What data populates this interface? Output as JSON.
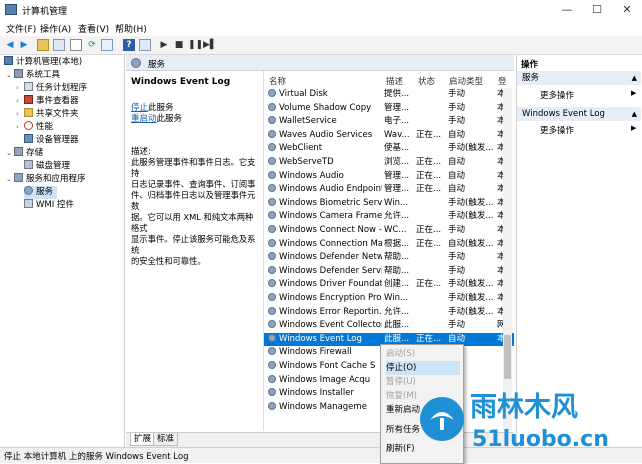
{
  "window": {
    "title": "计算机管理",
    "controls": [
      "—",
      "☐",
      "✕"
    ]
  },
  "menu": [
    "文件(F)",
    "操作(A)",
    "查看(V)",
    "帮助(H)"
  ],
  "tree": {
    "root": "计算机管理(本地)",
    "items": [
      {
        "label": "系统工具",
        "level": 1
      },
      {
        "label": "任务计划程序",
        "level": 2
      },
      {
        "label": "事件查看器",
        "level": 2
      },
      {
        "label": "共享文件夹",
        "level": 2
      },
      {
        "label": "性能",
        "level": 2
      },
      {
        "label": "设备管理器",
        "level": 2
      },
      {
        "label": "存储",
        "level": 1
      },
      {
        "label": "磁盘管理",
        "level": 2
      },
      {
        "label": "服务和应用程序",
        "level": 1
      },
      {
        "label": "服务",
        "level": 2
      },
      {
        "label": "WMI 控件",
        "level": 2
      }
    ]
  },
  "services_header": "服务",
  "description": {
    "title": "Windows Event Log",
    "stop_link": "停止",
    "stop_suffix": "此服务",
    "restart_link": "重启动",
    "restart_suffix": "此服务",
    "desc_label": "描述:",
    "desc_lines": [
      "此服务管理事件和事件日志。它支持",
      "日志记录事件、查询事件、订阅事",
      "件、归档事件日志以及管理事件元数",
      "据。它可以用 XML 和纯文本两种格式",
      "显示事件。停止该服务可能危及系统",
      "的安全性和可靠性。"
    ]
  },
  "columns": {
    "name": "名称",
    "desc": "描述",
    "status": "状态",
    "startup": "启动类型",
    "logon": "登"
  },
  "rows": [
    {
      "name": "Virtual Disk",
      "desc": "提供...",
      "status": "",
      "startup": "手动",
      "logon": "本"
    },
    {
      "name": "Volume Shadow Copy",
      "desc": "管理...",
      "status": "",
      "startup": "手动",
      "logon": "本"
    },
    {
      "name": "WalletService",
      "desc": "电子...",
      "status": "",
      "startup": "手动",
      "logon": "本"
    },
    {
      "name": "Waves Audio Services",
      "desc": "Wav...",
      "status": "正在...",
      "startup": "自动",
      "logon": "本"
    },
    {
      "name": "WebClient",
      "desc": "使基...",
      "status": "",
      "startup": "手动(触发...",
      "logon": "本"
    },
    {
      "name": "WebServeTD",
      "desc": "浏览...",
      "status": "正在...",
      "startup": "自动",
      "logon": "本"
    },
    {
      "name": "Windows Audio",
      "desc": "管理...",
      "status": "正在...",
      "startup": "自动",
      "logon": "本"
    },
    {
      "name": "Windows Audio Endpoint...",
      "desc": "管理...",
      "status": "正在...",
      "startup": "自动",
      "logon": "本"
    },
    {
      "name": "Windows Biometric Servic...",
      "desc": "Win...",
      "status": "",
      "startup": "手动(触发...",
      "logon": "本"
    },
    {
      "name": "Windows Camera Frame ...",
      "desc": "允许...",
      "status": "",
      "startup": "手动(触发...",
      "logon": "本"
    },
    {
      "name": "Windows Connect Now - ...",
      "desc": "WC...",
      "status": "正在...",
      "startup": "手动",
      "logon": "本"
    },
    {
      "name": "Windows Connection Ma...",
      "desc": "根据...",
      "status": "正在...",
      "startup": "自动(触发...",
      "logon": "本"
    },
    {
      "name": "Windows Defender Netw...",
      "desc": "帮助...",
      "status": "",
      "startup": "手动",
      "logon": "本"
    },
    {
      "name": "Windows Defender Service",
      "desc": "帮助...",
      "status": "",
      "startup": "手动",
      "logon": "本"
    },
    {
      "name": "Windows Driver Foundati...",
      "desc": "创建...",
      "status": "正在...",
      "startup": "手动(触发...",
      "logon": "本"
    },
    {
      "name": "Windows Encryption Pro...",
      "desc": "Win...",
      "status": "",
      "startup": "手动(触发...",
      "logon": "本"
    },
    {
      "name": "Windows Error Reportin...",
      "desc": "允许...",
      "status": "",
      "startup": "手动(触发...",
      "logon": "本"
    },
    {
      "name": "Windows Event Collector",
      "desc": "此服...",
      "status": "",
      "startup": "手动",
      "logon": "网"
    },
    {
      "name": "Windows Event Log",
      "desc": "此服...",
      "status": "正在...",
      "startup": "自动",
      "logon": "本"
    },
    {
      "name": "Windows Firewall",
      "desc": "",
      "status": "",
      "startup": "",
      "logon": ""
    },
    {
      "name": "Windows Font Cache S",
      "desc": "",
      "status": "",
      "startup": "",
      "logon": ""
    },
    {
      "name": "Windows Image Acqu",
      "desc": "",
      "status": "",
      "startup": "",
      "logon": ""
    },
    {
      "name": "Windows Installer",
      "desc": "",
      "status": "",
      "startup": "",
      "logon": ""
    },
    {
      "name": "Windows Manageme",
      "desc": "",
      "status": "",
      "startup": "",
      "logon": ""
    }
  ],
  "tabs": [
    "扩展",
    "标准"
  ],
  "actions": {
    "header": "操作",
    "group1": "服务",
    "more1": "更多操作",
    "group2": "Windows Event Log",
    "more2": "更多操作"
  },
  "status": "停止 本地计算机 上的服务 Windows Event Log",
  "context_menu": [
    {
      "label": "启动(S)",
      "state": "disabled"
    },
    {
      "label": "停止(O)",
      "state": "highlight"
    },
    {
      "label": "暂停(U)",
      "state": "disabled"
    },
    {
      "label": "恢复(M)",
      "state": "disabled"
    },
    {
      "label": "重新启动",
      "state": "normal"
    },
    {
      "label": "所有任务",
      "state": "normal"
    },
    {
      "label": "刷新(F)",
      "state": "normal"
    }
  ],
  "watermark": {
    "brand": "雨林木风",
    "site": "51luobo.cn"
  },
  "colors": {
    "selection": "#0078d7",
    "accent": "#1a5fb4",
    "watermark": "#1f8fd6"
  }
}
